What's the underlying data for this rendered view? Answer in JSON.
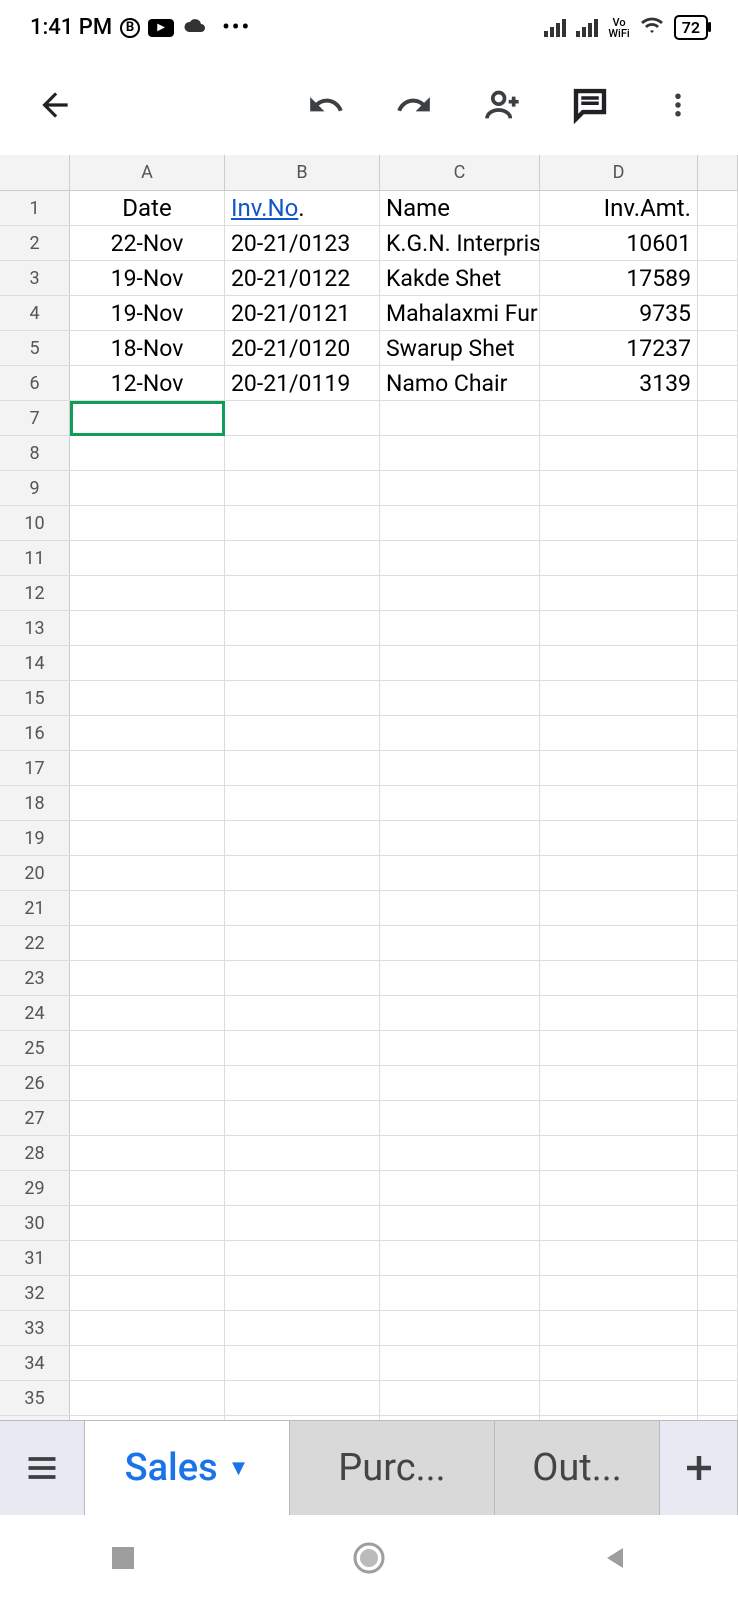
{
  "status": {
    "time": "1:41 PM",
    "battery": "72",
    "wifi_label": "Vo\nWiFi"
  },
  "columns": [
    "A",
    "B",
    "C",
    "D"
  ],
  "headers": {
    "A": "Date",
    "B_link": "Inv.No",
    "B_dot": ".",
    "C": "Name",
    "D": "Inv.Amt."
  },
  "rows": [
    {
      "A": "22-Nov",
      "B": "20-21/0123",
      "C": "K.G.N. Interpris",
      "D": "10601"
    },
    {
      "A": "19-Nov",
      "B": "20-21/0122",
      "C": "Kakde Shet",
      "D": "17589"
    },
    {
      "A": "19-Nov",
      "B": "20-21/0121",
      "C": "Mahalaxmi Furn",
      "D": "9735"
    },
    {
      "A": "18-Nov",
      "B": "20-21/0120",
      "C": "Swarup Shet",
      "D": "17237"
    },
    {
      "A": "12-Nov",
      "B": "20-21/0119",
      "C": "Namo Chair",
      "D": "3139"
    }
  ],
  "total_rows": 36,
  "selected_cell": {
    "row": 7,
    "col": "A"
  },
  "tabs": {
    "active": "Sales",
    "others": [
      "Purc...",
      "Out..."
    ]
  }
}
